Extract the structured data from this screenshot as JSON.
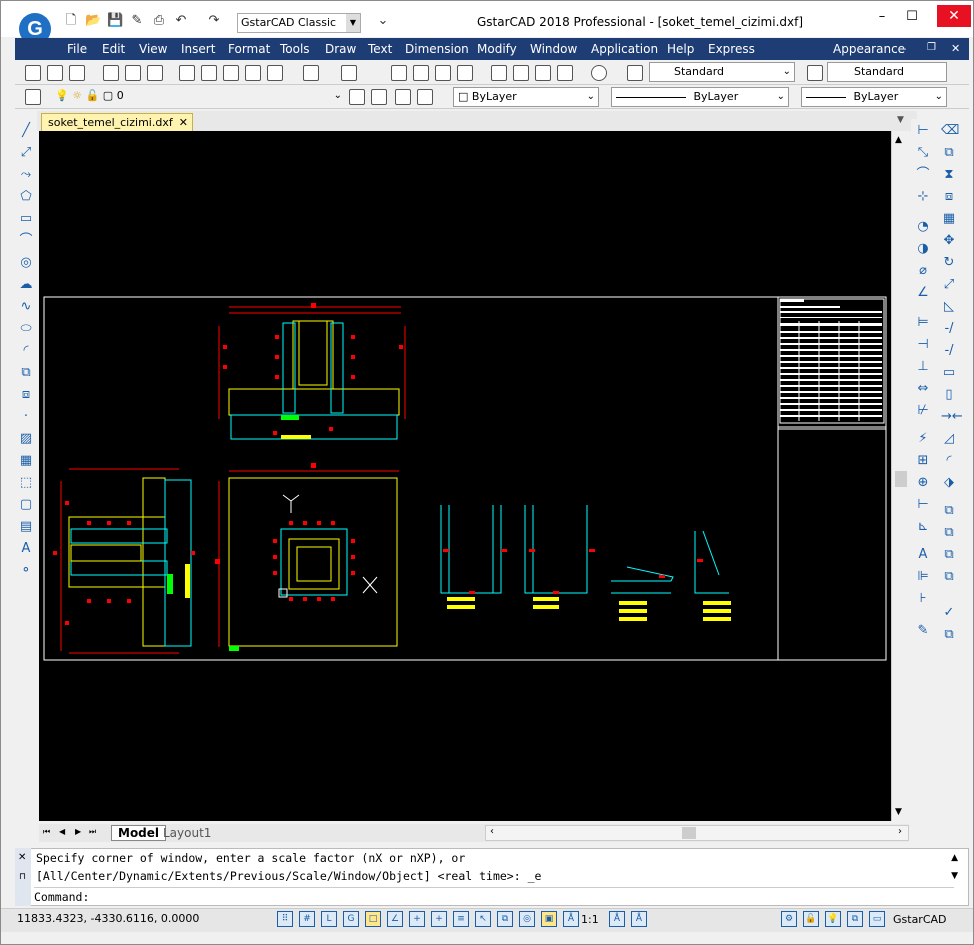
{
  "window": {
    "workspace": "GstarCAD Classic",
    "title": "GstarCAD 2018 Professional - [soket_temel_cizimi.dxf]",
    "minimize": "–",
    "restore": "☐",
    "close": "✕"
  },
  "menu": {
    "items": [
      "File",
      "Edit",
      "View",
      "Insert",
      "Format",
      "Tools",
      "Draw",
      "Text",
      "Dimension",
      "Modify",
      "Window",
      "Application",
      "Help",
      "Express"
    ],
    "appearance": "Appearance"
  },
  "toolbar": {
    "text_style": "Standard",
    "dim_style": "Standard",
    "layer": "0",
    "color": "ByLayer",
    "linetype": "ByLayer",
    "lineweight": "ByLayer"
  },
  "doc_tab": "soket_temel_cizimi.dxf",
  "layout_tabs": {
    "model": "Model",
    "layout1": "Layout1"
  },
  "command": {
    "line1": "Specify corner of window, enter a scale factor (nX or nXP), or",
    "line2": "[All/Center/Dynamic/Extents/Previous/Scale/Window/Object] <real time>: _e",
    "prompt": "Command:"
  },
  "status": {
    "coords": "11833.4323, -4330.6116, 0.0000",
    "scale": "1:1",
    "app": "GstarCAD"
  },
  "colors": {
    "menubar": "#1e3d75",
    "canvas": "#000000",
    "cad_white": "#ffffff",
    "cad_cyan": "#00ffff",
    "cad_yellow": "#ffff00",
    "cad_red": "#ff0000",
    "cad_green": "#00ff00"
  }
}
